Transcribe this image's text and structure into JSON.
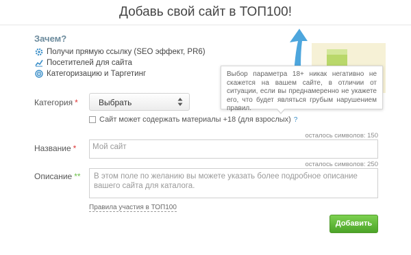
{
  "header": {
    "title": "Добавь свой сайт в ТОП100!"
  },
  "why": {
    "title": "Зачем?",
    "items": [
      {
        "icon": "gear-icon",
        "label": "Получи прямую ссылку (SEO эффект, PR6)"
      },
      {
        "icon": "chart-icon",
        "label": "Посетителей для сайта"
      },
      {
        "icon": "target-icon",
        "label": "Категоризацию и Таргетинг"
      }
    ]
  },
  "form": {
    "category": {
      "label": "Категория",
      "required_mark": "*",
      "value": "Выбрать"
    },
    "adult": {
      "label": "Сайт может содержать материалы +18 (для взрослых)",
      "help": "?"
    },
    "name": {
      "label": "Название",
      "required_mark": "*",
      "placeholder": "Мой сайт",
      "counter": "осталось символов: 150"
    },
    "description": {
      "label": "Описание",
      "required_mark": "**",
      "placeholder": "В этом поле по желанию вы можете указать более подробное описание вашего сайта для каталога.",
      "counter": "осталось символов: 250"
    },
    "rules_link": "Правила участия в ТОП100",
    "submit": "Добавить"
  },
  "tooltip": {
    "text": "Выбор параметра 18+ никак негативно не скажется на вашем сайте, в отличии от ситуации, если вы преднамеренно не укажете его, что будет являться грубым нарушением правил."
  },
  "colors": {
    "accent_green": "#5cb832",
    "required_red": "#dd3333",
    "link_blue": "#3a8ec8"
  }
}
